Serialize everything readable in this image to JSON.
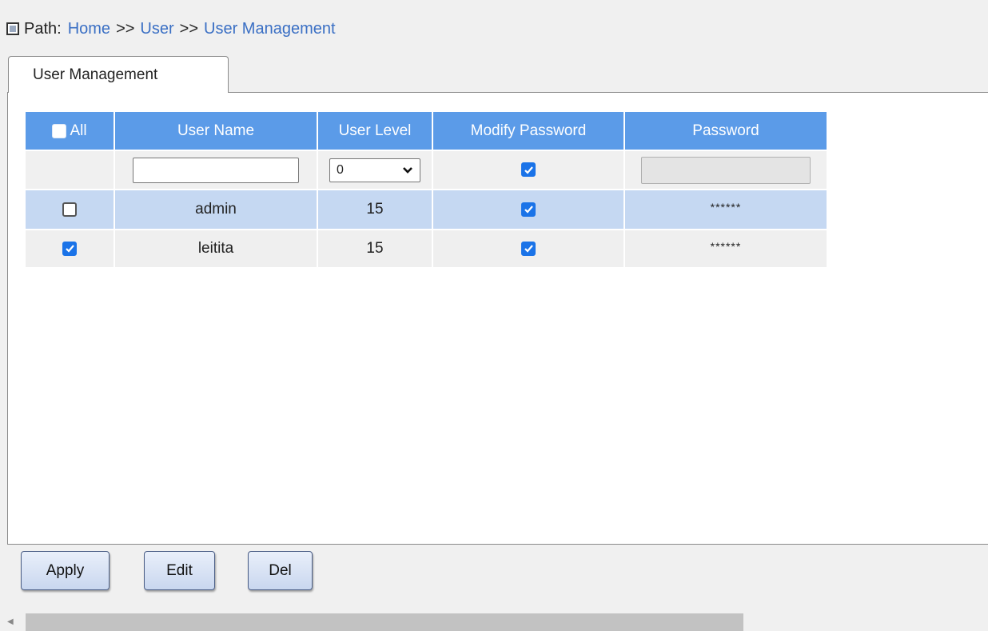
{
  "path": {
    "label": "Path:",
    "crumbs": [
      "Home",
      "User",
      "User Management"
    ],
    "separator": ">>"
  },
  "tab": {
    "label": "User Management"
  },
  "table": {
    "headers": {
      "all": "All",
      "user_name": "User Name",
      "user_level": "User Level",
      "modify_password": "Modify Password",
      "password": "Password"
    },
    "input_row": {
      "user_name_value": "",
      "user_level_value": "0",
      "modify_password_checked": true,
      "password_value": ""
    },
    "rows": [
      {
        "selected": false,
        "user_name": "admin",
        "user_level": "15",
        "modify_password": true,
        "password": "******"
      },
      {
        "selected": true,
        "user_name": "leitita",
        "user_level": "15",
        "modify_password": true,
        "password": "******"
      }
    ]
  },
  "buttons": {
    "apply": "Apply",
    "edit": "Edit",
    "del": "Del"
  },
  "colors": {
    "header_bg": "#5b9be8",
    "selected_row": "#c5d8f2",
    "link": "#3a6fc4",
    "checkbox": "#1a73e8"
  }
}
